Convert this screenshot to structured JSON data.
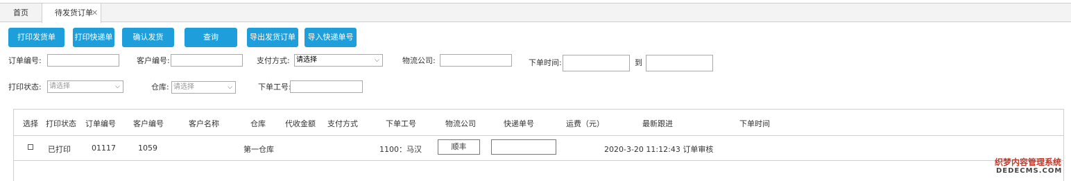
{
  "tabs": {
    "home": "首页",
    "active": "待发货订单",
    "close": "✕"
  },
  "toolbar": {
    "print_ship_order": "打印发货单",
    "print_express": "打印快递单",
    "confirm_ship": "确认发货",
    "query": "查询",
    "export_orders": "导出发货订单",
    "import_tracking": "导入快递单号"
  },
  "filters": {
    "order_no_label": "订单编号:",
    "customer_no_label": "客户编号:",
    "payment_label": "支付方式:",
    "payment_value": "请选择",
    "logistics_label": "物流公司:",
    "order_time_label": "下单时间:",
    "to_label": "到",
    "print_status_label": "打印状态:",
    "print_status_value": "请选择",
    "warehouse_label": "仓库:",
    "warehouse_value": "请选择",
    "staff_no_label": "下单工号:"
  },
  "table": {
    "headers": {
      "select": "选择",
      "print_status": "打印状态",
      "order_no": "订单编号",
      "customer_no": "客户编号",
      "customer_name": "客户名称",
      "warehouse": "仓库",
      "cod_amount": "代收金额",
      "payment": "支付方式",
      "staff_no": "下单工号",
      "logistics": "物流公司",
      "tracking_no": "快递单号",
      "shipping_fee": "运费（元）",
      "latest_follow": "最新跟进",
      "order_time": "下单时间"
    },
    "rows": [
      {
        "print_status": "已打印",
        "order_no": "01117",
        "customer_no": "1059",
        "warehouse": "第一仓库",
        "staff_no": "1100：马汉",
        "logistics": "顺丰",
        "tracking_no": "",
        "latest_follow": "2020-3-20 11:12:43 订单审核"
      }
    ]
  },
  "watermark": {
    "line1": "织梦内容管理系统",
    "line2": "DEDECMS.COM"
  },
  "colors": {
    "button_bg": "#1e9fdb",
    "watermark_red": "#c0392b"
  }
}
